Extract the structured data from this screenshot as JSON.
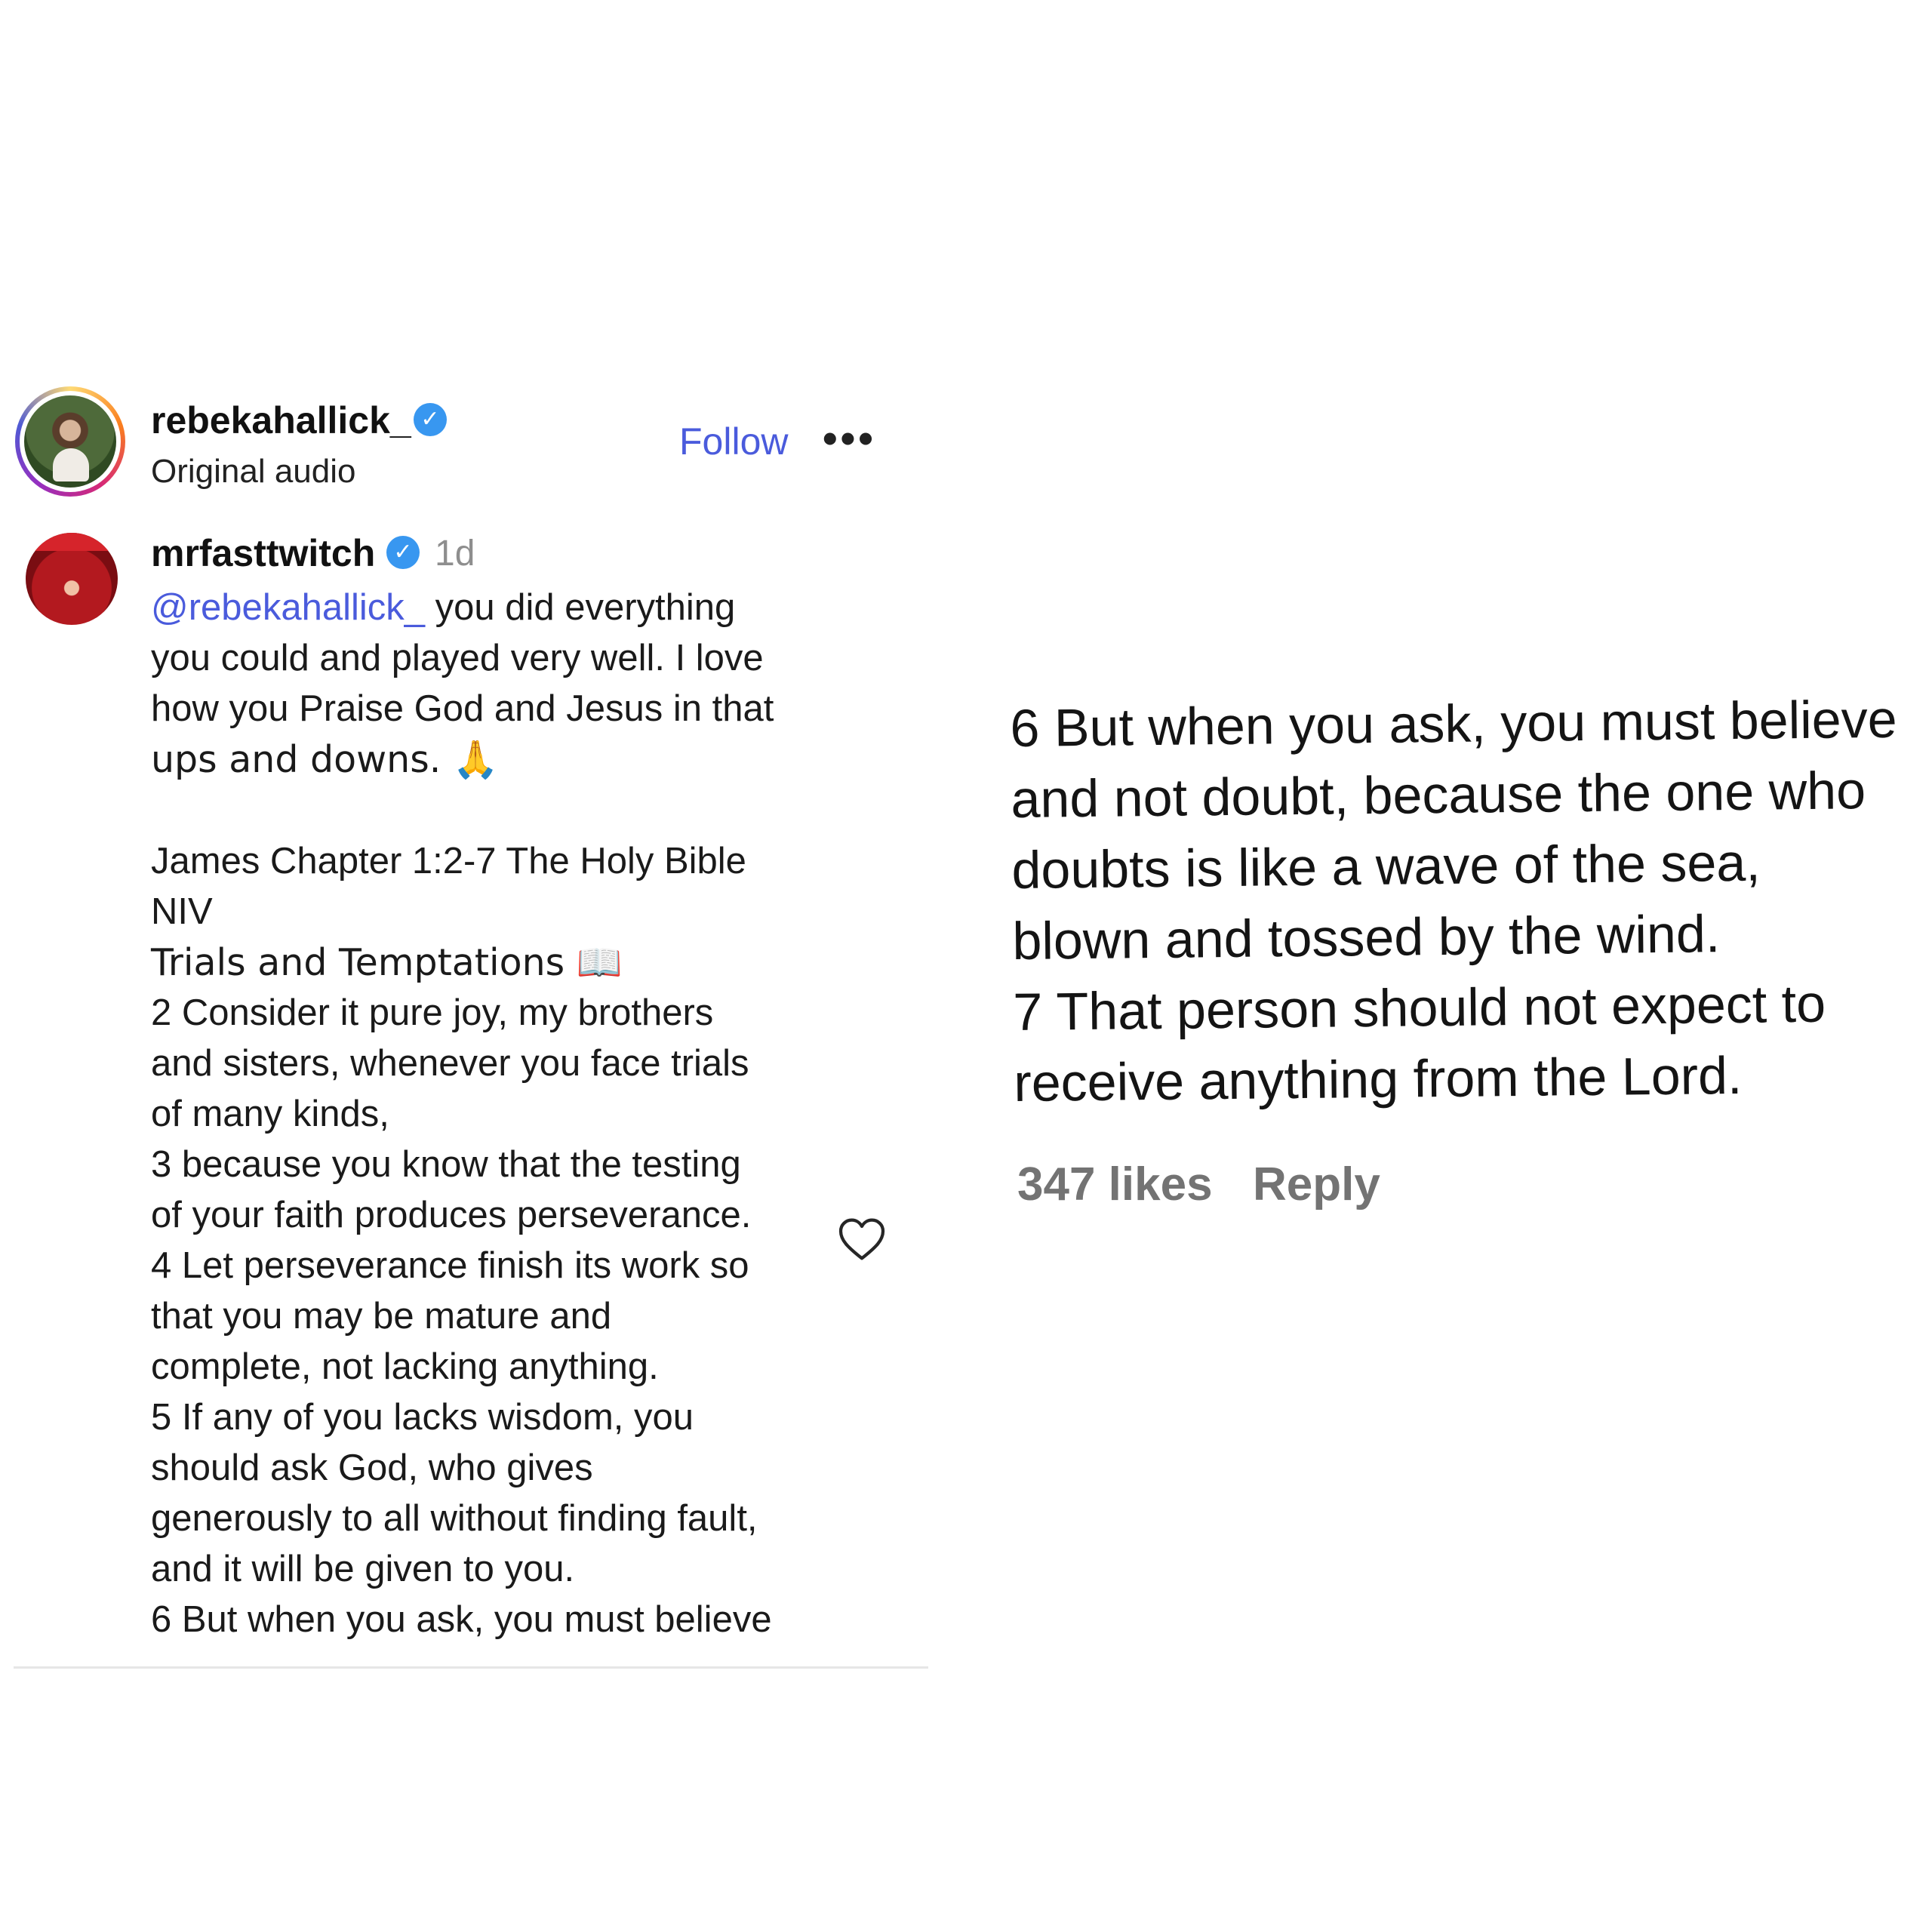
{
  "post_header": {
    "username": "rebekahallick_",
    "subtitle": "Original audio",
    "follow_label": "Follow",
    "more_label": "•••"
  },
  "comment": {
    "username": "mrfasttwitch",
    "time": "1d",
    "mention": "@rebekahallick_",
    "lines": [
      " you did everything",
      "you could and played very well. I love",
      "how you Praise God and Jesus in that",
      "ups and downs. 🙏",
      "James Chapter 1:2-7 The Holy Bible",
      "NIV",
      "Trials and Temptations 📖",
      "2 Consider it pure joy, my brothers",
      "and sisters, whenever you face trials",
      "of many kinds,",
      "3 because you know that the testing",
      "of your faith produces perseverance.",
      "4 Let perseverance finish its work so",
      "that you may be mature and",
      "complete, not lacking anything.",
      "5 If any of you lacks wisdom, you",
      "should ask God, who gives",
      "generously to all without finding fault,",
      "and it will be given to you.",
      "6 But when you ask, you must believe"
    ]
  },
  "zoom": {
    "lines": [
      "6 But when you ask, you must believe",
      "and not doubt, because the one who",
      "doubts is like a wave of the sea,",
      "blown and tossed by the wind.",
      "7 That person should not expect to",
      "receive anything from the Lord."
    ],
    "likes_label": "347 likes",
    "reply_label": "Reply"
  },
  "icons": {
    "verified": "verified-badge-icon",
    "heart": "heart-icon",
    "more": "more-options-icon"
  },
  "colors": {
    "link_blue": "#4a5bdc",
    "verified_blue": "#3897f0",
    "muted_gray": "#737373"
  }
}
